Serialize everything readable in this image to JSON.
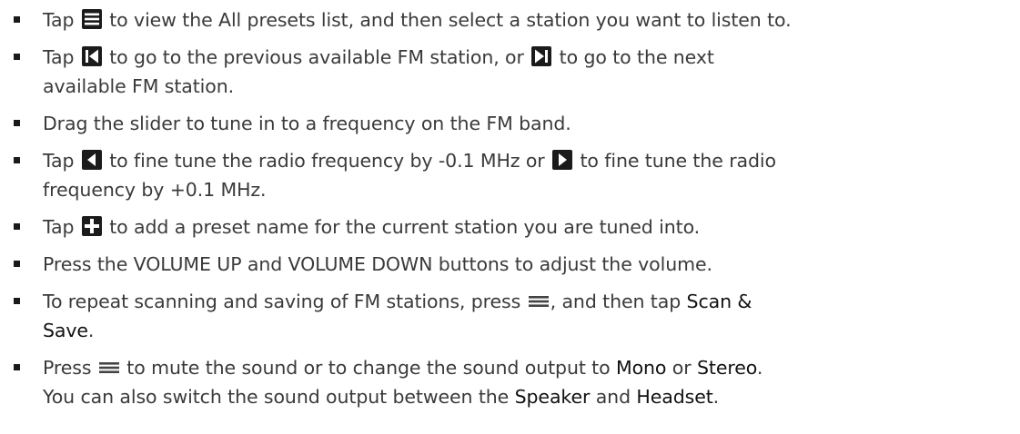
{
  "colors": {
    "text": "#3a3a3a",
    "icon_dark": "#1b1b1b",
    "icon_light": "#ffffff",
    "menu_key": "#444444"
  },
  "items": [
    {
      "part1": "Tap ",
      "icon": "list-icon",
      "part2": " to view the All presets list, and then select a station you want to listen to."
    },
    {
      "part1": "Tap ",
      "icon": "previous-station-icon",
      "part2": " to go to the previous available FM station, or ",
      "icon2": "next-station-icon",
      "part3": " to go to the next",
      "line2": "available FM station."
    },
    {
      "text": "Drag the slider to tune in to a frequency on the FM band."
    },
    {
      "part1": "Tap ",
      "icon": "fine-tune-down-icon",
      "part2": " to fine tune the radio frequency by -0.1 MHz or ",
      "icon2": "fine-tune-up-icon",
      "part3": " to fine tune the radio",
      "line2": "frequency by +0.1 MHz."
    },
    {
      "part1": "Tap ",
      "icon": "add-preset-icon",
      "part2": " to add a preset name for the current station you are tuned into."
    },
    {
      "text": "Press the VOLUME UP and VOLUME DOWN buttons to adjust the volume."
    },
    {
      "part1": "To repeat scanning and saving of FM stations, press ",
      "icon": "menu-key-icon",
      "part2": ", and then tap ",
      "bold1": "Scan &",
      "line2_bold": "Save",
      "line2_rest": "."
    },
    {
      "part1": "Press ",
      "icon": "menu-key-icon",
      "part2": " to mute the sound or to change the sound output to ",
      "bold1": "Mono",
      "part3": " or ",
      "bold2": "Stereo",
      "part4": ".",
      "line2_part1": "You can also switch the sound output between the ",
      "line2_bold1": "Speaker",
      "line2_part2": " and ",
      "line2_bold2": "Headset",
      "line2_part3": "."
    }
  ]
}
